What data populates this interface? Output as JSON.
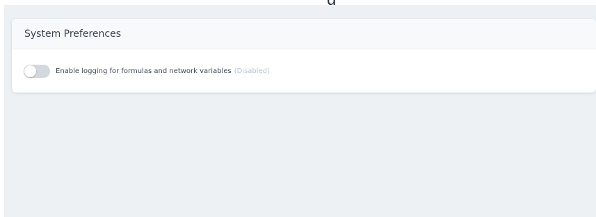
{
  "top_fragment": "g",
  "panel": {
    "title": "System Preferences",
    "setting": {
      "label": "Enable logging for formulas and network variables",
      "status": "(Disabled)",
      "enabled": false
    }
  },
  "colors": {
    "background": "#eef1f4",
    "toggle_track_off": "#d3d8df",
    "status_text": "#b7c3d8"
  }
}
